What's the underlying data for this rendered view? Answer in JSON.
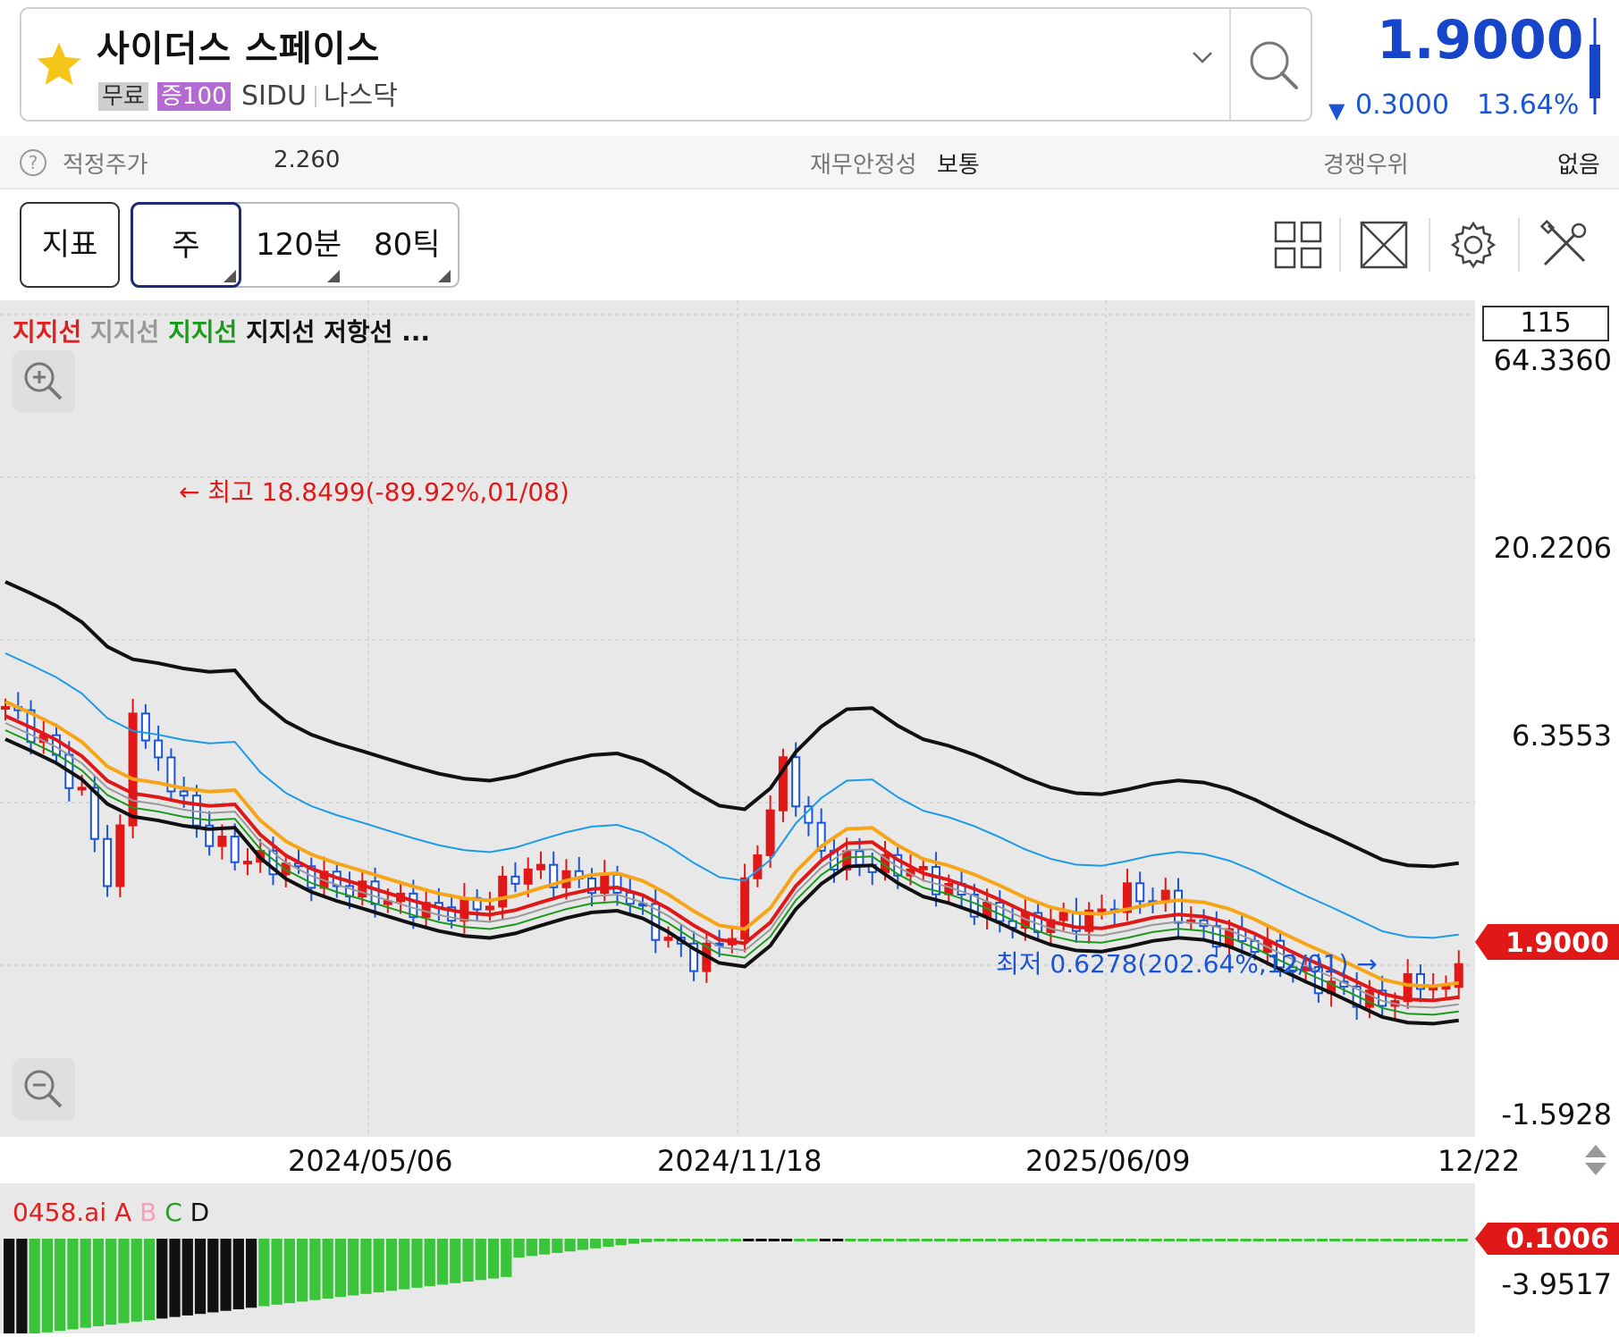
{
  "header": {
    "stock_name": "사이더스 스페이스",
    "tag_free": "무료",
    "tag_margin": "증100",
    "ticker": "SIDU",
    "exchange": "나스닥",
    "price": "1.9000",
    "change_value": "0.3000",
    "change_pct": "13.64%",
    "change_direction": "down",
    "colors": {
      "price": "#1745c9",
      "up": "#e02020",
      "down": "#1a55d8",
      "favorite": "#f5b800"
    }
  },
  "info_bar": {
    "fair_price_label": "적정주가",
    "fair_price_value": "2.260",
    "stability_label": "재무안정성",
    "stability_value": "보통",
    "competitive_label": "경쟁우위",
    "competitive_value": "없음"
  },
  "toolbar": {
    "indicator_label": "지표",
    "period_label": "주",
    "minute_label": "120분",
    "tick_label": "80틱",
    "right_icons": [
      "grid-layout-icon",
      "fullscreen-icon",
      "settings-icon",
      "tools-icon"
    ]
  },
  "chart": {
    "legend": [
      {
        "text": "지지선",
        "color": "#e02020"
      },
      {
        "text": "지지선",
        "color": "#999999"
      },
      {
        "text": "지지선",
        "color": "#1a9a1a"
      },
      {
        "text": "지지선",
        "color": "#111111"
      },
      {
        "text": "저항선",
        "color": "#111111"
      },
      {
        "text": "...",
        "color": "#111111"
      }
    ],
    "count": "115",
    "current_price_tag": "1.9000",
    "high_annotation": "최고 18.8499(-89.92%,01/08)",
    "low_annotation": "최저 0.6278(202.64%,12/01)"
  },
  "chart_data": {
    "type": "candlestick",
    "scale": "log",
    "y_tick_labels": [
      "64.3360",
      "20.2206",
      "6.3553",
      "-1.5928"
    ],
    "x_tick_labels": [
      "2024/05/06",
      "2024/11/18",
      "2025/06/09",
      "12/22"
    ],
    "series": [
      {
        "name": "지지선",
        "color": "#e02020"
      },
      {
        "name": "지지선",
        "color": "#999999"
      },
      {
        "name": "지지선",
        "color": "#1a9a1a"
      },
      {
        "name": "지지선",
        "color": "#111111"
      },
      {
        "name": "저항선",
        "color": "#111111"
      }
    ],
    "high": {
      "value": 18.8499,
      "pct": "-89.92%",
      "date": "01/08"
    },
    "low": {
      "value": 0.6278,
      "pct": "202.64%",
      "date": "12/01"
    },
    "last": 1.9
  },
  "sub_chart": {
    "legend_prefix": "0458.ai",
    "legend_items": [
      {
        "text": "A",
        "color": "#e02020"
      },
      {
        "text": "B",
        "color": "#f2a0c0"
      },
      {
        "text": "C",
        "color": "#2aa02a"
      },
      {
        "text": "D",
        "color": "#111111"
      }
    ],
    "value_tag": "0.1006",
    "min_label": "-3.9517"
  }
}
